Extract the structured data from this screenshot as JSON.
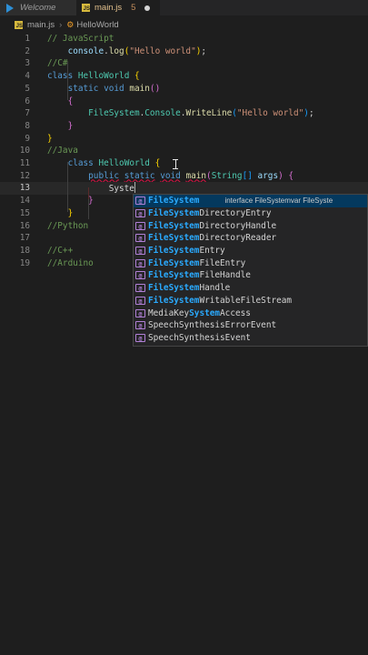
{
  "tabs": [
    {
      "label": "Welcome",
      "icon": "vscode-icon",
      "active": false
    },
    {
      "label": "main.js",
      "icon": "js-file-icon",
      "active": true,
      "count": "5"
    }
  ],
  "breadcrumb": {
    "file": "main.js",
    "symbol": "HelloWorld"
  },
  "lines": [
    {
      "n": "1",
      "tokens": [
        [
          "c",
          "// JavaScript"
        ]
      ]
    },
    {
      "n": "2",
      "tokens": [
        [
          "p",
          "    "
        ],
        [
          "v",
          "console"
        ],
        [
          "p",
          "."
        ],
        [
          "f",
          "log"
        ],
        [
          "b1",
          "("
        ],
        [
          "s",
          "\"Hello world\""
        ],
        [
          "b1",
          ")"
        ],
        [
          "p",
          ";"
        ]
      ]
    },
    {
      "n": "3",
      "tokens": [
        [
          "c",
          "//C#"
        ]
      ]
    },
    {
      "n": "4",
      "tokens": [
        [
          "k",
          "class"
        ],
        [
          "p",
          " "
        ],
        [
          "t",
          "HelloWorld"
        ],
        [
          "p",
          " "
        ],
        [
          "b1",
          "{"
        ]
      ]
    },
    {
      "n": "5",
      "tokens": [
        [
          "p",
          "    "
        ],
        [
          "k",
          "static"
        ],
        [
          "p",
          " "
        ],
        [
          "k",
          "void"
        ],
        [
          "p",
          " "
        ],
        [
          "f",
          "main"
        ],
        [
          "b2",
          "()"
        ]
      ]
    },
    {
      "n": "6",
      "tokens": [
        [
          "p",
          "    "
        ],
        [
          "b2",
          "{"
        ]
      ]
    },
    {
      "n": "7",
      "tokens": [
        [
          "p",
          "        "
        ],
        [
          "t",
          "FileSystem"
        ],
        [
          "p",
          "."
        ],
        [
          "t",
          "Console"
        ],
        [
          "p",
          "."
        ],
        [
          "f",
          "WriteLine"
        ],
        [
          "b3",
          "("
        ],
        [
          "s",
          "\"Hello world\""
        ],
        [
          "b3",
          ")"
        ],
        [
          "p",
          ";"
        ]
      ]
    },
    {
      "n": "8",
      "tokens": [
        [
          "p",
          "    "
        ],
        [
          "b2",
          "}"
        ]
      ]
    },
    {
      "n": "9",
      "tokens": [
        [
          "b1",
          "}"
        ]
      ]
    },
    {
      "n": "10",
      "tokens": [
        [
          "c",
          "//Java"
        ]
      ]
    },
    {
      "n": "11",
      "tokens": [
        [
          "p",
          "    "
        ],
        [
          "k",
          "class"
        ],
        [
          "p",
          " "
        ],
        [
          "t",
          "HelloWorld"
        ],
        [
          "p",
          " "
        ],
        [
          "b1",
          "{"
        ]
      ]
    },
    {
      "n": "12",
      "tokens": [
        [
          "p",
          "        "
        ],
        [
          "kq",
          "public"
        ],
        [
          "p",
          " "
        ],
        [
          "kq",
          "static"
        ],
        [
          "p",
          " "
        ],
        [
          "kq",
          "void"
        ],
        [
          "p",
          " "
        ],
        [
          "fq",
          "main"
        ],
        [
          "b2",
          "("
        ],
        [
          "t",
          "String"
        ],
        [
          "b3",
          "[]"
        ],
        [
          "p",
          " "
        ],
        [
          "v",
          "args"
        ],
        [
          "b2",
          ")"
        ],
        [
          "p",
          " "
        ],
        [
          "b2",
          "{"
        ]
      ]
    },
    {
      "n": "13",
      "tokens": [
        [
          "p",
          "            "
        ],
        [
          "p",
          "Syste"
        ]
      ]
    },
    {
      "n": "14",
      "tokens": [
        [
          "p",
          "        "
        ],
        [
          "b2",
          "}"
        ]
      ]
    },
    {
      "n": "15",
      "tokens": [
        [
          "p",
          "    "
        ],
        [
          "b1",
          "}"
        ]
      ]
    },
    {
      "n": "16",
      "tokens": [
        [
          "c",
          "//Python"
        ]
      ]
    },
    {
      "n": "17",
      "tokens": []
    },
    {
      "n": "18",
      "tokens": [
        [
          "c",
          "//C++"
        ]
      ]
    },
    {
      "n": "19",
      "tokens": [
        [
          "c",
          "//Arduino"
        ]
      ]
    }
  ],
  "current_line": "13",
  "suggestions": [
    {
      "match": "FileSystem",
      "rest": "",
      "detail": "interface FileSystemvar FileSyste"
    },
    {
      "match": "FileSystem",
      "rest": "DirectoryEntry"
    },
    {
      "match": "FileSystem",
      "rest": "DirectoryHandle"
    },
    {
      "match": "FileSystem",
      "rest": "DirectoryReader"
    },
    {
      "match": "FileSystem",
      "rest": "Entry"
    },
    {
      "match": "FileSystem",
      "rest": "FileEntry"
    },
    {
      "match": "FileSystem",
      "rest": "FileHandle"
    },
    {
      "match": "FileSystem",
      "rest": "Handle"
    },
    {
      "match": "FileSystem",
      "rest": "WritableFileStream"
    },
    {
      "pre": "MediaKey",
      "match": "System",
      "rest": "Access"
    },
    {
      "pre": "SpeechSynthesisErrorEvent"
    },
    {
      "pre": "SpeechSynthesisEvent"
    }
  ],
  "suggestion_icon": "[@]",
  "colors": {
    "background": "#1e1e1e",
    "selection": "#04395e",
    "accent": "#2aaaff"
  }
}
